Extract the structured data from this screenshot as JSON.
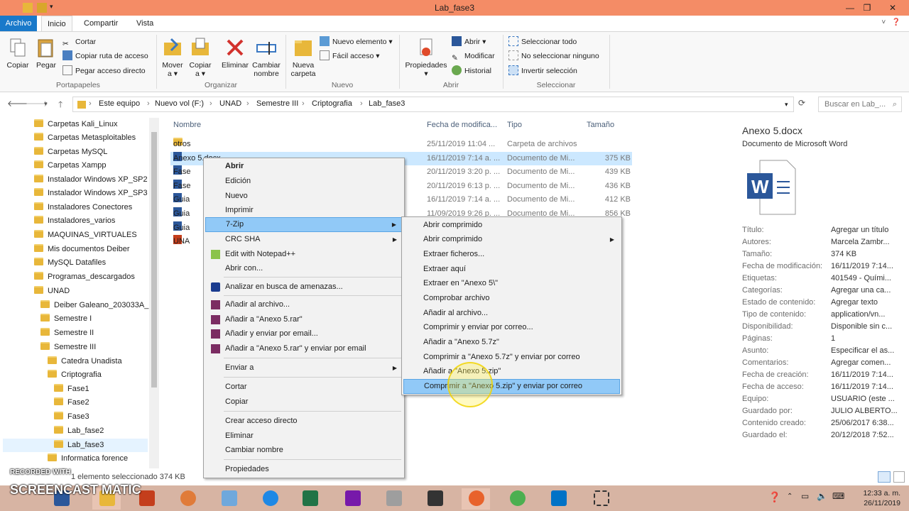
{
  "window": {
    "title": "Lab_fase3"
  },
  "tabs": [
    "Archivo",
    "Inicio",
    "Compartir",
    "Vista"
  ],
  "ribbon": {
    "portapapeles": {
      "label": "Portapapeles",
      "copiar": "Copiar",
      "pegar": "Pegar",
      "cortar": "Cortar",
      "copiar_ruta": "Copiar ruta de acceso",
      "pegar_acceso": "Pegar acceso directo"
    },
    "organizar": {
      "label": "Organizar",
      "mover": "Mover",
      "mover2": "a ▾",
      "copiar": "Copiar",
      "copiar2": "a ▾",
      "eliminar": "Eliminar",
      "cambiar": "Cambiar",
      "cambiar2": "nombre"
    },
    "nuevo": {
      "label": "Nuevo",
      "carpeta": "Nueva",
      "carpeta2": "carpeta",
      "elemento": "Nuevo elemento ▾",
      "facil": "Fácil acceso ▾"
    },
    "abrir": {
      "label": "Abrir",
      "propiedades": "Propiedades",
      "abrir": "Abrir ▾",
      "modificar": "Modificar",
      "historial": "Historial"
    },
    "seleccionar": {
      "label": "Seleccionar",
      "todo": "Seleccionar todo",
      "ninguno": "No seleccionar ninguno",
      "invertir": "Invertir selección"
    }
  },
  "address": {
    "crumbs": [
      "Este equipo",
      "Nuevo vol (F:)",
      "UNAD",
      "Semestre III",
      "Criptografia",
      "Lab_fase3"
    ],
    "search_placeholder": "Buscar en Lab_..."
  },
  "nav": [
    "Carpetas Kali_Linux",
    "Carpetas Metasploitables",
    "Carpetas MySQL",
    "Carpetas Xampp",
    "Instalador Windows XP_SP2",
    "Instalador Windows XP_SP3",
    "Instaladores Conectores",
    "Instaladores_varios",
    "MAQUINAS_VIRTUALES",
    "Mis documentos Deiber",
    "MySQL Datafiles",
    "Programas_descargados",
    "UNAD",
    "Deiber Galeano_203033A_6",
    "Semestre I",
    "Semestre II",
    "Semestre III",
    "Catedra Unadista",
    "Criptografia",
    "Fase1",
    "Fase2",
    "Fase3",
    "Lab_fase2",
    "Lab_fase3",
    "Informatica forence"
  ],
  "columns": {
    "nombre": "Nombre",
    "fecha": "Fecha de modifica...",
    "tipo": "Tipo",
    "tamano": "Tamaño"
  },
  "files": [
    {
      "name": "otros",
      "date": "25/11/2019 11:04 ...",
      "type": "Carpeta de archivos",
      "size": ""
    },
    {
      "name": "Anexo 5.docx",
      "date": "16/11/2019 7:14 a. ...",
      "type": "Documento de Mi...",
      "size": "375 KB"
    },
    {
      "name": "Fase",
      "date": "20/11/2019 3:20 p. ...",
      "type": "Documento de Mi...",
      "size": "439 KB"
    },
    {
      "name": "Fase",
      "date": "20/11/2019 6:13 p. ...",
      "type": "Documento de Mi...",
      "size": "436 KB"
    },
    {
      "name": "Guia",
      "date": "16/11/2019 7:14 a. ...",
      "type": "Documento de Mi...",
      "size": "412 KB"
    },
    {
      "name": "Guia",
      "date": "11/09/2019 9:26 p. ...",
      "type": "Documento de Mi...",
      "size": "856 KB"
    },
    {
      "name": "Guia",
      "date": "",
      "type": "",
      "size": ""
    },
    {
      "name": "UNA",
      "date": "",
      "type": "",
      "size": ""
    }
  ],
  "menu1": [
    "Abrir",
    "Edición",
    "Nuevo",
    "Imprimir",
    "7-Zip",
    "CRC SHA",
    "Edit with Notepad++",
    "Abrir con...",
    "Analizar en busca de amenazas...",
    "Añadir al archivo...",
    "Añadir a \"Anexo 5.rar\"",
    "Añadir y enviar por email...",
    "Añadir a \"Anexo 5.rar\" y enviar por email",
    "Enviar a",
    "Cortar",
    "Copiar",
    "Crear acceso directo",
    "Eliminar",
    "Cambiar nombre",
    "Propiedades"
  ],
  "menu2": [
    "Abrir comprimido",
    "Abrir comprimido",
    "Extraer ficheros...",
    "Extraer aquí",
    "Extraer en \"Anexo 5\\\"",
    "Comprobar archivo",
    "Añadir al archivo...",
    "Comprimir y enviar por correo...",
    "Añadir a \"Anexo 5.7z\"",
    "Comprimir a \"Anexo 5.7z\" y enviar por correo",
    "Añadir a \"Anexo 5.zip\"",
    "Comprimir a \"Anexo 5.zip\" y enviar por correo"
  ],
  "details": {
    "name": "Anexo 5.docx",
    "type": "Documento de Microsoft Word",
    "props": [
      [
        "Título:",
        "Agregar un título"
      ],
      [
        "Autores:",
        "Marcela Zambr..."
      ],
      [
        "Tamaño:",
        "374 KB"
      ],
      [
        "Fecha de modificación:",
        "16/11/2019 7:14..."
      ],
      [
        "Etiquetas:",
        "401549 - Quími..."
      ],
      [
        "Categorías:",
        "Agregar una ca..."
      ],
      [
        "Estado de contenido:",
        "Agregar texto"
      ],
      [
        "Tipo de contenido:",
        "application/vn..."
      ],
      [
        "Disponibilidad:",
        "Disponible sin c..."
      ],
      [
        "Páginas:",
        "1"
      ],
      [
        "Asunto:",
        "Especificar el as..."
      ],
      [
        "Comentarios:",
        "Agregar comen..."
      ],
      [
        "Fecha de creación:",
        "16/11/2019 7:14..."
      ],
      [
        "Fecha de acceso:",
        "16/11/2019 7:14..."
      ],
      [
        "Equipo:",
        "USUARIO (este ..."
      ],
      [
        "Guardado por:",
        "JULIO ALBERTO..."
      ],
      [
        "Contenido creado:",
        "25/06/2017 6:38..."
      ],
      [
        "Guardado el:",
        "20/12/2018 7:52..."
      ]
    ]
  },
  "status": {
    "text": "1 elemento seleccionado  374 KB"
  },
  "watermark": {
    "line1": "RECORDED WITH",
    "line2": "SCREENCAST MATIC"
  },
  "clock": {
    "time": "12:33 a. m.",
    "date": "26/11/2019"
  },
  "colors": {
    "titlebar": "#f48c66",
    "file_tab": "#1979ca",
    "highlight": "#91c9f7",
    "selection": "#cce8ff"
  }
}
